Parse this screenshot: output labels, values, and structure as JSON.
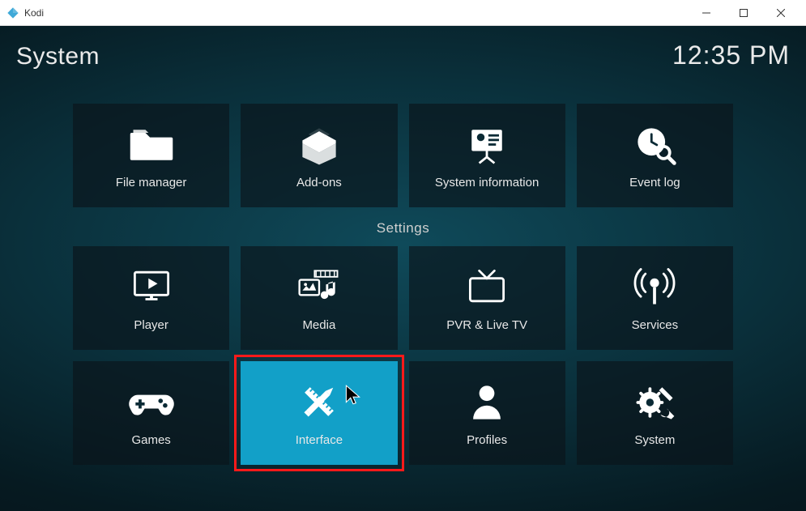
{
  "window": {
    "title": "Kodi"
  },
  "header": {
    "page_title": "System",
    "clock": "12:35 PM"
  },
  "section_label": "Settings",
  "row1": [
    {
      "name": "file-manager",
      "label": "File manager",
      "icon": "folder-icon"
    },
    {
      "name": "add-ons",
      "label": "Add-ons",
      "icon": "box-icon"
    },
    {
      "name": "system-information",
      "label": "System information",
      "icon": "presentation-icon"
    },
    {
      "name": "event-log",
      "label": "Event log",
      "icon": "clock-search-icon"
    }
  ],
  "row2": [
    {
      "name": "player",
      "label": "Player",
      "icon": "monitor-play-icon"
    },
    {
      "name": "media",
      "label": "Media",
      "icon": "media-icon"
    },
    {
      "name": "pvr-live-tv",
      "label": "PVR & Live TV",
      "icon": "tv-icon"
    },
    {
      "name": "services",
      "label": "Services",
      "icon": "broadcast-icon"
    }
  ],
  "row3": [
    {
      "name": "games",
      "label": "Games",
      "icon": "gamepad-icon"
    },
    {
      "name": "interface",
      "label": "Interface",
      "icon": "ruler-pencil-icon",
      "selected": true,
      "highlighted": true
    },
    {
      "name": "profiles",
      "label": "Profiles",
      "icon": "person-icon"
    },
    {
      "name": "system",
      "label": "System",
      "icon": "gear-tools-icon"
    }
  ],
  "cursor_on": "interface"
}
